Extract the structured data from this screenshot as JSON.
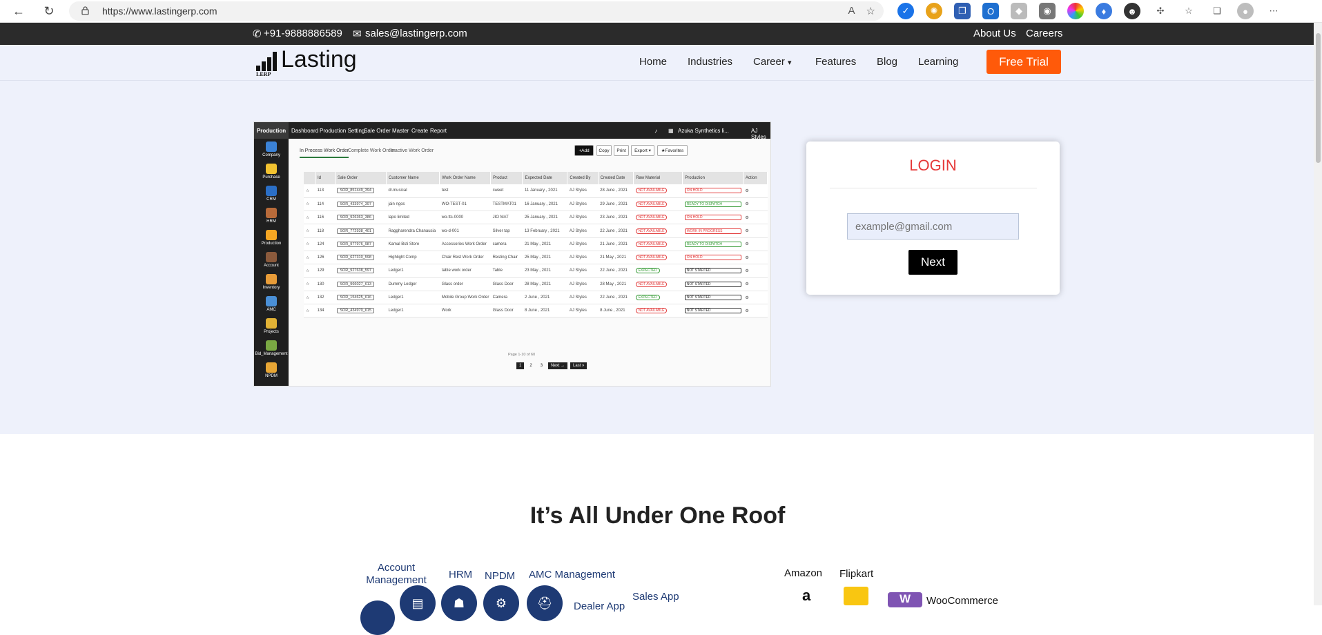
{
  "browser": {
    "url": "https://www.lastingerp.com",
    "extensions": [
      "translate-icon",
      "star-icon",
      "check-icon",
      "ext-sun-icon",
      "chat-icon",
      "outlook-icon",
      "shield-icon",
      "camera-icon",
      "color-wheel-icon",
      "droplet-icon",
      "avatar-ext-icon",
      "puzzle-icon",
      "favorites-icon",
      "collections-icon",
      "profile-icon",
      "more-icon"
    ]
  },
  "topbar": {
    "phone": "+91-9888886589",
    "email": "sales@lastingerp.com",
    "about": "About Us",
    "careers": "Careers"
  },
  "header": {
    "logo_text": "Lasting",
    "logo_sub": "LERP",
    "nav": [
      "Home",
      "Industries",
      "Career",
      "Features",
      "Blog",
      "Learning"
    ],
    "career_caret": "▾",
    "cta": "Free Trial",
    "cta_color": "#ff5a0a"
  },
  "dashboard": {
    "brand": "Production",
    "menu": [
      "Dashboard",
      "Production Setting",
      "Sale Order",
      "Master",
      "Create",
      "Report"
    ],
    "company": "Azuka Synthetics li...",
    "user": "AJ Styles",
    "sidebar": [
      "Company",
      "Purchase",
      "CRM",
      "HRM",
      "Production",
      "Account",
      "Inventory",
      "AMC",
      "Projects",
      "Bid_Management",
      "NPDM"
    ],
    "tabs": [
      "In Process Work Order",
      "Complete Work Order",
      "Inactive Work Order"
    ],
    "buttons": [
      "+Add",
      "Copy",
      "Print",
      "Export ▾",
      "★Favorites"
    ],
    "columns": [
      "Id",
      "Sale Order",
      "Customer Name",
      "Work Order Name",
      "Product",
      "Expected Date",
      "Created By",
      "Created Date",
      "Raw Material",
      "Production",
      "Action"
    ],
    "rows": [
      [
        "113",
        "SOR_851449_394",
        "dr.musical",
        "test",
        "sweet",
        "11 January , 2021",
        "AJ Styles",
        "28 June , 2021",
        "NOT AVAILABLE",
        "ON HOLD"
      ],
      [
        "114",
        "SOR_433974_397",
        "jain ngos",
        "WO-TEST-01",
        "TESTMAT01",
        "16 January , 2021",
        "AJ Styles",
        "29 June , 2021",
        "NOT AVAILABLE",
        "READY TO DISPATCH"
      ],
      [
        "116",
        "SOR_926363_386",
        "lapo limited",
        "wo-tts-0000",
        "JIO MAT",
        "25 January , 2021",
        "AJ Styles",
        "23 June , 2021",
        "NOT AVAILABLE",
        "ON HOLD"
      ],
      [
        "118",
        "SOR_772938_401",
        "Raggharendra Chanausia",
        "wo-d-001",
        "Silver tap",
        "13 February , 2021",
        "AJ Styles",
        "22 June , 2021",
        "NOT AVAILABLE",
        "WORK IN PROGRESS"
      ],
      [
        "124",
        "SOR_977976_987",
        "Kamal Bsti Store",
        "Accessories Work Order",
        "camera",
        "21 May , 2021",
        "AJ Styles",
        "21 June , 2021",
        "NOT AVAILABLE",
        "READY TO DISPATCH"
      ],
      [
        "126",
        "SOR_627310_598",
        "Highlight Comp",
        "Chair Rest Work Order",
        "Resting Chair",
        "25 May , 2021",
        "AJ Styles",
        "21 May , 2021",
        "NOT AVAILABLE",
        "ON HOLD"
      ],
      [
        "129",
        "SOR_927638_597",
        "Ledger1",
        "table work order",
        "Table",
        "23 May , 2021",
        "AJ Styles",
        "22 June , 2021",
        "EXPECTED",
        "NOT STARTED"
      ],
      [
        "130",
        "SOR_966027_613",
        "Dummy Ledger",
        "Glass order",
        "Glass Door",
        "28 May , 2021",
        "AJ Styles",
        "28 May , 2021",
        "NOT AVAILABLE",
        "NOT STARTED"
      ],
      [
        "132",
        "SOR_154625_616",
        "Ledger1",
        "Mobile Group Work Order",
        "Camera",
        "2 June , 2021",
        "AJ Styles",
        "22 June , 2021",
        "EXPECTED",
        "NOT STARTED"
      ],
      [
        "134",
        "SOR_434970_615",
        "Ledger1",
        "Work",
        "Glass Door",
        "8 June , 2021",
        "AJ Styles",
        "8 June , 2021",
        "NOT AVAILABLE",
        "NOT STARTED"
      ]
    ],
    "page_info": "Page 1-10 of 60",
    "pager": [
      "1",
      "2",
      "3",
      "Next →",
      "Last »"
    ]
  },
  "login": {
    "title": "LOGIN",
    "placeholder": "example@gmail.com",
    "next": "Next"
  },
  "section2": {
    "title": "It’s All Under One Roof",
    "modules": [
      "Account Management",
      "HRM",
      "NPDM",
      "AMC Management",
      "Dealer App",
      "Sales App",
      "Amazon",
      "Flipkart",
      "WooCommerce"
    ]
  }
}
